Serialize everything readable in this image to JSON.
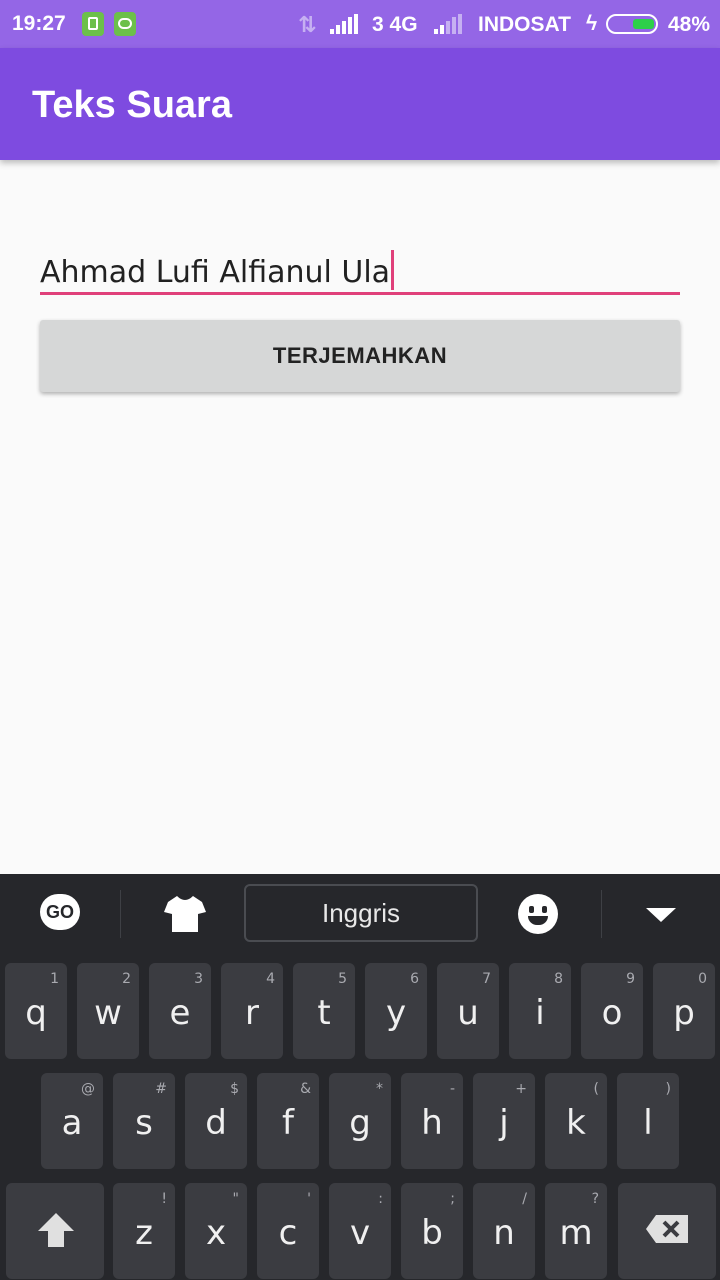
{
  "status_bar": {
    "time": "19:27",
    "network": "3 4G",
    "carrier": "INDOSAT",
    "battery": "48%",
    "battery_level": 0.48
  },
  "app_bar": {
    "title": "Teks Suara"
  },
  "input": {
    "value": "Ahmad Lufi Alfianul Ula"
  },
  "translate_button": {
    "label": "TERJEMAHKAN"
  },
  "keyboard": {
    "logo_text": "GO",
    "language": "Inggris",
    "row1": [
      {
        "key": "q",
        "hint": "1"
      },
      {
        "key": "w",
        "hint": "2"
      },
      {
        "key": "e",
        "hint": "3"
      },
      {
        "key": "r",
        "hint": "4"
      },
      {
        "key": "t",
        "hint": "5"
      },
      {
        "key": "y",
        "hint": "6"
      },
      {
        "key": "u",
        "hint": "7"
      },
      {
        "key": "i",
        "hint": "8"
      },
      {
        "key": "o",
        "hint": "9"
      },
      {
        "key": "p",
        "hint": "0"
      }
    ],
    "row2": [
      {
        "key": "a",
        "hint": "@"
      },
      {
        "key": "s",
        "hint": "#"
      },
      {
        "key": "d",
        "hint": "$"
      },
      {
        "key": "f",
        "hint": "&"
      },
      {
        "key": "g",
        "hint": "*"
      },
      {
        "key": "h",
        "hint": "-"
      },
      {
        "key": "j",
        "hint": "+"
      },
      {
        "key": "k",
        "hint": "("
      },
      {
        "key": "l",
        "hint": ")"
      }
    ],
    "row3": [
      {
        "key": "z",
        "hint": "!"
      },
      {
        "key": "x",
        "hint": "\""
      },
      {
        "key": "c",
        "hint": "'"
      },
      {
        "key": "v",
        "hint": ":"
      },
      {
        "key": "b",
        "hint": ";"
      },
      {
        "key": "n",
        "hint": "/"
      },
      {
        "key": "m",
        "hint": "?"
      }
    ]
  }
}
